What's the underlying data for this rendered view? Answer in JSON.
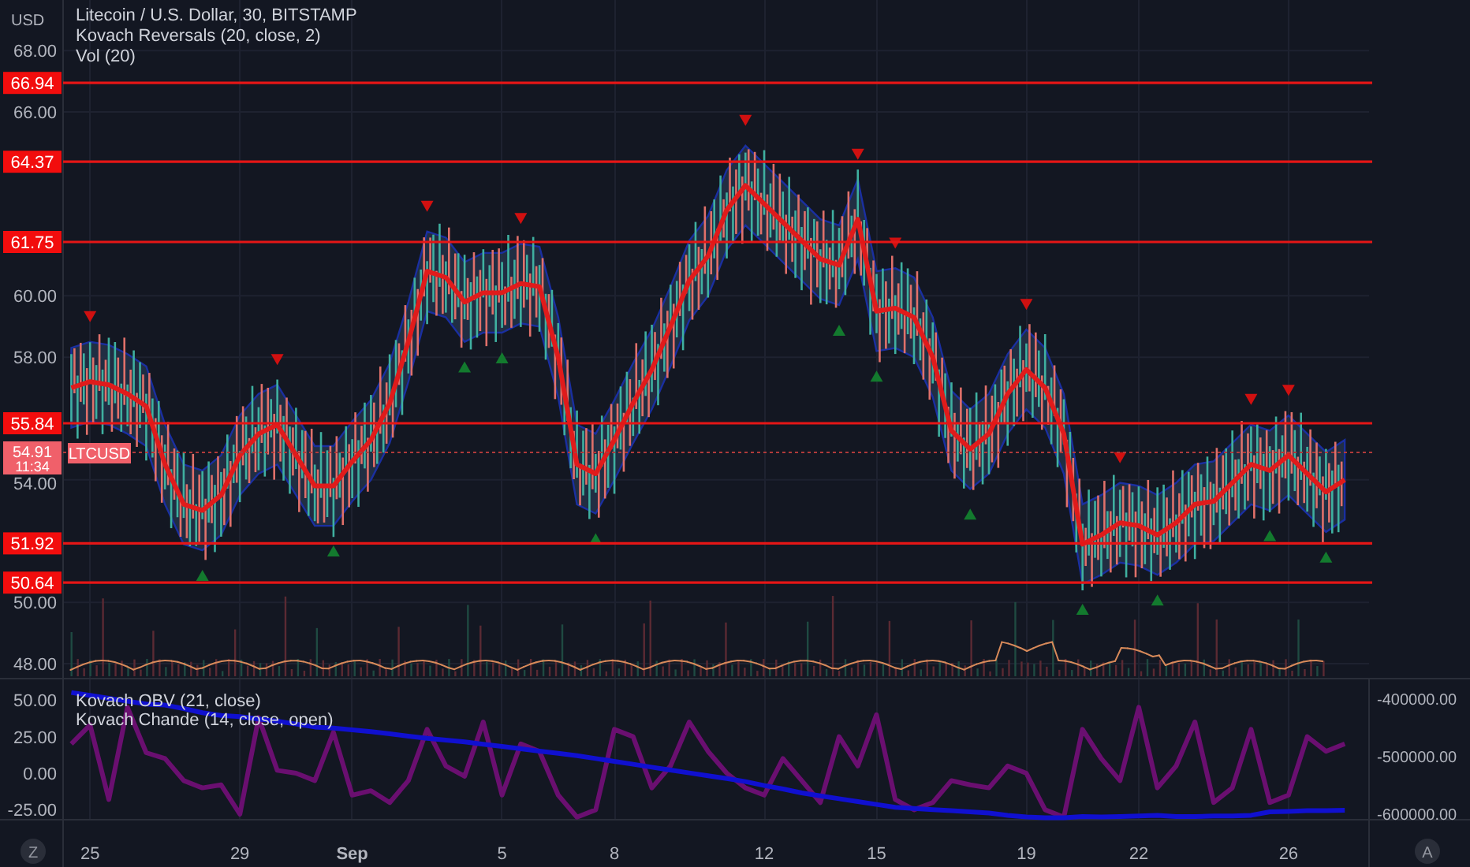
{
  "header": {
    "currency": "USD",
    "legend": [
      "Litecoin / U.S. Dollar, 30, BITSTAMP",
      "Kovach Reversals (20, close, 2)",
      "Vol (20)"
    ]
  },
  "price_pane": {
    "chart_data": {
      "type": "line",
      "categories": [
        null,
        "25",
        null,
        null,
        null,
        null,
        null,
        null,
        null,
        "29",
        null,
        null,
        null,
        null,
        null,
        "Sep",
        null,
        null,
        null,
        null,
        null,
        null,
        null,
        "5",
        null,
        null,
        null,
        null,
        null,
        "8",
        null,
        null,
        null,
        null,
        null,
        null,
        null,
        "12",
        null,
        null,
        null,
        null,
        null,
        "15",
        null,
        null,
        null,
        null,
        null,
        null,
        null,
        "19",
        null,
        null,
        null,
        null,
        null,
        "22",
        null,
        null,
        null,
        null,
        null,
        null,
        null,
        "26",
        null,
        null,
        null
      ],
      "series": [
        {
          "color": "#e01b1b",
          "values": [
            57.0,
            57.2,
            57.1,
            56.8,
            56.4,
            54.5,
            53.2,
            53.0,
            53.5,
            54.8,
            55.5,
            55.8,
            54.8,
            53.8,
            53.8,
            54.6,
            55.3,
            56.5,
            58.5,
            60.8,
            60.6,
            59.8,
            60.1,
            60.1,
            60.4,
            60.3,
            58.0,
            54.5,
            54.2,
            55.3,
            56.5,
            57.6,
            59.0,
            60.5,
            61.3,
            62.8,
            63.6,
            63.0,
            62.4,
            61.8,
            61.2,
            61.0,
            62.5,
            59.5,
            59.6,
            59.3,
            58.0,
            55.6,
            55.0,
            55.5,
            56.8,
            57.6,
            57.0,
            55.5,
            51.9,
            52.2,
            52.6,
            52.5,
            52.2,
            52.6,
            53.2,
            53.3,
            53.9,
            54.5,
            54.3,
            54.8,
            54.2,
            53.6,
            54.0
          ]
        }
      ],
      "ylim": [
        41.37,
        69.65
      ],
      "yticks": [
        {
          "value": 48,
          "label": "48.00"
        },
        {
          "value": 50,
          "label": "50.00"
        },
        {
          "value": 54,
          "label": "54.00"
        },
        {
          "value": 58,
          "label": "58.00"
        },
        {
          "value": 60,
          "label": "60.00"
        },
        {
          "value": 66,
          "label": "66.00"
        },
        {
          "value": 68,
          "label": "68.00"
        }
      ]
    },
    "levels": [
      {
        "label": "66.94"
      },
      {
        "label": "64.37"
      },
      {
        "label": "61.75"
      },
      {
        "label": "55.84"
      },
      {
        "label": "51.92"
      },
      {
        "label": "50.64"
      }
    ],
    "last_price": {
      "price": "54.91",
      "countdown": "11:34",
      "symbol": "LTCUSD"
    }
  },
  "oscillator_pane": {
    "legend": [
      "Kovach OBV (21, close)",
      "Kovach Chande (14, close, open)"
    ],
    "charts": [
      {
        "chart_data": {
          "type": "line",
          "series": [
            {
              "color": "#6a0f70",
              "values": [
                20,
                33,
                -18,
                45,
                14,
                10,
                -5,
                -10,
                -8,
                -28,
                38,
                2,
                0,
                -5,
                28,
                -15,
                -12,
                -20,
                -5,
                30,
                5,
                -2,
                35,
                -15,
                20,
                15,
                -15,
                -30,
                -25,
                30,
                25,
                -10,
                5,
                35,
                15,
                0,
                -10,
                -15,
                10,
                -5,
                -20,
                25,
                5,
                40,
                -18,
                -25,
                -20,
                -5,
                -8,
                -10,
                5,
                0,
                -25,
                -30,
                30,
                10,
                -5,
                45,
                -10,
                5,
                35,
                -20,
                -10,
                30,
                -20,
                -15,
                25,
                15,
                20
              ]
            }
          ],
          "ylim": [
            -64.1,
            65.2
          ],
          "yticks": [
            {
              "value": 50,
              "label": "50.00"
            },
            {
              "value": 25,
              "label": "25.00"
            },
            {
              "value": 0,
              "label": "0.00"
            },
            {
              "value": -25,
              "label": "-25.00"
            }
          ]
        }
      },
      {
        "chart_data": {
          "type": "line",
          "series": [
            {
              "color": "#1010d0",
              "values": [
                -390000,
                -395000,
                -400000,
                -405000,
                -410000,
                -412000,
                -418000,
                -425000,
                -430000,
                -432000,
                -436000,
                -440000,
                -445000,
                -450000,
                -452000,
                -455000,
                -458000,
                -462000,
                -466000,
                -470000,
                -473000,
                -476000,
                -480000,
                -484000,
                -488000,
                -492000,
                -496000,
                -500000,
                -505000,
                -510000,
                -515000,
                -520000,
                -525000,
                -530000,
                -535000,
                -540000,
                -545000,
                -552000,
                -558000,
                -565000,
                -570000,
                -575000,
                -580000,
                -585000,
                -590000,
                -592000,
                -594000,
                -596000,
                -598000,
                -600000,
                -604000,
                -607000,
                -608000,
                -608000,
                -606000,
                -607000,
                -606000,
                -605000,
                -604000,
                -606000,
                -606000,
                -605000,
                -605000,
                -604000,
                -598000,
                -597000,
                -596000,
                -596000,
                -595000
              ]
            }
          ],
          "ylim": [
            -694000,
            -364400
          ],
          "yticks": [
            {
              "value": -400000,
              "label": "-400000.00"
            },
            {
              "value": -500000,
              "label": "-500000.00"
            },
            {
              "value": -600000,
              "label": "-600000.00"
            }
          ]
        }
      }
    ]
  },
  "footer": {
    "left_button": "Z",
    "right_button": "A"
  }
}
